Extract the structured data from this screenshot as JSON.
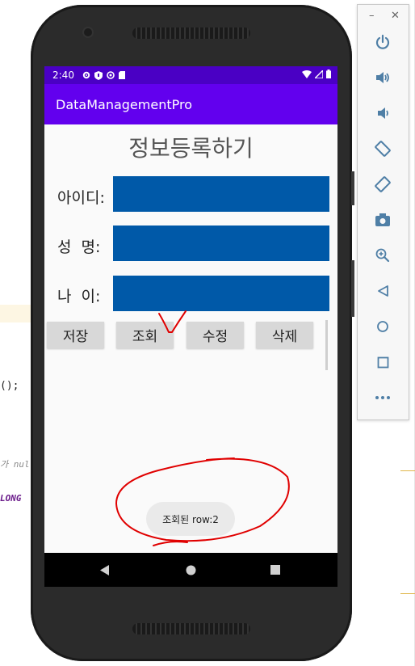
{
  "ide": {
    "fragment_1": "();",
    "fragment_2": "가 nul",
    "fragment_3": "LONG"
  },
  "status_bar": {
    "time": "2:40"
  },
  "app_bar": {
    "title": "DataManagementPro"
  },
  "form": {
    "title": "정보등록하기",
    "fields": [
      {
        "label": "아이디:",
        "value": ""
      },
      {
        "label": "성  명:",
        "value": ""
      },
      {
        "label": "나  이:",
        "value": ""
      }
    ],
    "input_color": "#0059a8"
  },
  "buttons": {
    "save": "저장",
    "query": "조회",
    "update": "수정",
    "delete": "삭제"
  },
  "toast": {
    "message": "조회된 row:2"
  },
  "colors": {
    "status_bar": "#4a00c4",
    "app_bar": "#6200ee",
    "annotation": "#e00000"
  },
  "emulator_toolbar": {
    "items": [
      "power-icon",
      "volume-up-icon",
      "volume-down-icon",
      "rotate-left-icon",
      "rotate-right-icon",
      "camera-icon",
      "zoom-icon",
      "back-icon",
      "home-icon",
      "overview-icon",
      "more-icon"
    ]
  }
}
